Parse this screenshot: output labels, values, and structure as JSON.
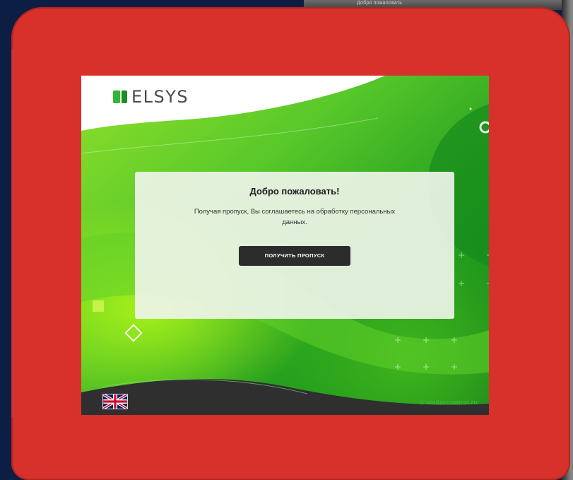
{
  "device": {
    "top_label": "Добро пожаловать"
  },
  "brand": {
    "logo_text": "ELSYS",
    "logo_color": "#33b536"
  },
  "welcome": {
    "title": "Добро пожаловать!",
    "text": "Получая пропуск, Вы соглашаетесь на обработку персональных данных.",
    "button_label": "ПОЛУЧИТЬ ПРОПУСК"
  },
  "footer": {
    "language_icon": "uk-flag-icon",
    "credit": "© visitorcontrol.ru"
  },
  "colors": {
    "frame_red": "#d8302b",
    "background_navy": "#0c1e44",
    "button_dark": "#2c2c2c",
    "accent_green": "#3fb536"
  }
}
